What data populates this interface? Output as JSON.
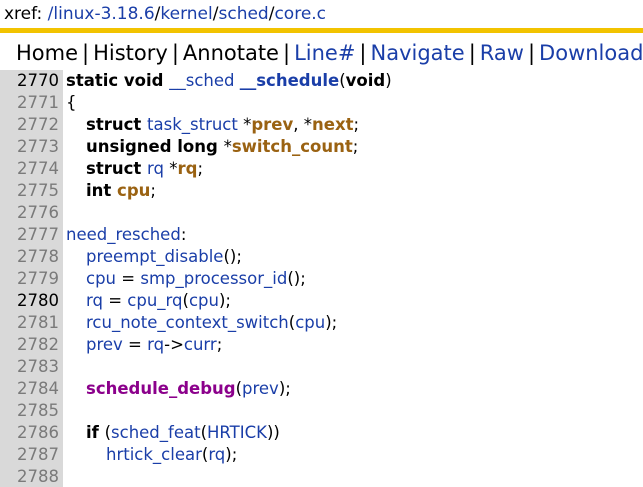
{
  "xref": {
    "prefix": "xref: ",
    "path": [
      {
        "text": "/linux-3.18.6",
        "link": true
      },
      {
        "text": "/",
        "link": false
      },
      {
        "text": "kernel",
        "link": true
      },
      {
        "text": "/",
        "link": false
      },
      {
        "text": "sched",
        "link": true
      },
      {
        "text": "/",
        "link": false
      },
      {
        "text": "core.c",
        "link": true
      }
    ]
  },
  "nav": {
    "items": [
      {
        "label": "Home",
        "link": false
      },
      {
        "label": "History",
        "link": false
      },
      {
        "label": "Annotate",
        "link": false
      },
      {
        "label": "Line#",
        "link": true
      },
      {
        "label": "Navigate",
        "link": true
      },
      {
        "label": "Raw",
        "link": true
      },
      {
        "label": "Download",
        "link": true
      }
    ]
  },
  "colors": {
    "rule": "#f2c300",
    "link": "#1a3ea8",
    "variable": "#9a6212",
    "macro": "#8b008b",
    "gutter": "#d9d9d9"
  },
  "lines": [
    {
      "n": "2770",
      "hl": true,
      "indent": 0,
      "tokens": [
        {
          "t": "static void ",
          "c": "kw"
        },
        {
          "t": "__sched",
          "c": "fn"
        },
        {
          "t": " ",
          "c": "pl"
        },
        {
          "t": "__schedule",
          "c": "fnb"
        },
        {
          "t": "(",
          "c": "pl"
        },
        {
          "t": "void",
          "c": "kw"
        },
        {
          "t": ")",
          "c": "pl"
        }
      ]
    },
    {
      "n": "2771",
      "hl": false,
      "indent": 0,
      "tokens": [
        {
          "t": "{",
          "c": "pl"
        }
      ]
    },
    {
      "n": "2772",
      "hl": false,
      "indent": 1,
      "tokens": [
        {
          "t": "struct ",
          "c": "kw"
        },
        {
          "t": "task_struct",
          "c": "fn"
        },
        {
          "t": " *",
          "c": "pl"
        },
        {
          "t": "prev",
          "c": "var"
        },
        {
          "t": ", *",
          "c": "pl"
        },
        {
          "t": "next",
          "c": "var"
        },
        {
          "t": ";",
          "c": "pl"
        }
      ]
    },
    {
      "n": "2773",
      "hl": false,
      "indent": 1,
      "tokens": [
        {
          "t": "unsigned long ",
          "c": "kw"
        },
        {
          "t": "*",
          "c": "pl"
        },
        {
          "t": "switch_count",
          "c": "var"
        },
        {
          "t": ";",
          "c": "pl"
        }
      ]
    },
    {
      "n": "2774",
      "hl": false,
      "indent": 1,
      "tokens": [
        {
          "t": "struct ",
          "c": "kw"
        },
        {
          "t": "rq",
          "c": "fn"
        },
        {
          "t": " *",
          "c": "pl"
        },
        {
          "t": "rq",
          "c": "var"
        },
        {
          "t": ";",
          "c": "pl"
        }
      ]
    },
    {
      "n": "2775",
      "hl": false,
      "indent": 1,
      "tokens": [
        {
          "t": "int ",
          "c": "kw"
        },
        {
          "t": "cpu",
          "c": "var"
        },
        {
          "t": ";",
          "c": "pl"
        }
      ]
    },
    {
      "n": "2776",
      "hl": false,
      "indent": 0,
      "tokens": []
    },
    {
      "n": "2777",
      "hl": false,
      "indent": 0,
      "tokens": [
        {
          "t": "need_resched",
          "c": "txt"
        },
        {
          "t": ":",
          "c": "pl"
        }
      ]
    },
    {
      "n": "2778",
      "hl": false,
      "indent": 1,
      "tokens": [
        {
          "t": "preempt_disable",
          "c": "fn"
        },
        {
          "t": "();",
          "c": "pl"
        }
      ]
    },
    {
      "n": "2779",
      "hl": false,
      "indent": 1,
      "tokens": [
        {
          "t": "cpu",
          "c": "txt"
        },
        {
          "t": " = ",
          "c": "pl"
        },
        {
          "t": "smp_processor_id",
          "c": "fn"
        },
        {
          "t": "();",
          "c": "pl"
        }
      ]
    },
    {
      "n": "2780",
      "hl": true,
      "indent": 1,
      "tokens": [
        {
          "t": "rq",
          "c": "txt"
        },
        {
          "t": " = ",
          "c": "pl"
        },
        {
          "t": "cpu_rq",
          "c": "fn"
        },
        {
          "t": "(",
          "c": "pl"
        },
        {
          "t": "cpu",
          "c": "txt"
        },
        {
          "t": ");",
          "c": "pl"
        }
      ]
    },
    {
      "n": "2781",
      "hl": false,
      "indent": 1,
      "tokens": [
        {
          "t": "rcu_note_context_switch",
          "c": "fn"
        },
        {
          "t": "(",
          "c": "pl"
        },
        {
          "t": "cpu",
          "c": "txt"
        },
        {
          "t": ");",
          "c": "pl"
        }
      ]
    },
    {
      "n": "2782",
      "hl": false,
      "indent": 1,
      "tokens": [
        {
          "t": "prev",
          "c": "txt"
        },
        {
          "t": " = ",
          "c": "pl"
        },
        {
          "t": "rq",
          "c": "txt"
        },
        {
          "t": "->",
          "c": "pl"
        },
        {
          "t": "curr",
          "c": "txt"
        },
        {
          "t": ";",
          "c": "pl"
        }
      ]
    },
    {
      "n": "2783",
      "hl": false,
      "indent": 0,
      "tokens": []
    },
    {
      "n": "2784",
      "hl": false,
      "indent": 1,
      "tokens": [
        {
          "t": "schedule_debug",
          "c": "mac"
        },
        {
          "t": "(",
          "c": "pl"
        },
        {
          "t": "prev",
          "c": "txt"
        },
        {
          "t": ");",
          "c": "pl"
        }
      ]
    },
    {
      "n": "2785",
      "hl": false,
      "indent": 0,
      "tokens": []
    },
    {
      "n": "2786",
      "hl": false,
      "indent": 1,
      "tokens": [
        {
          "t": "if ",
          "c": "kw"
        },
        {
          "t": "(",
          "c": "pl"
        },
        {
          "t": "sched_feat",
          "c": "fn"
        },
        {
          "t": "(",
          "c": "pl"
        },
        {
          "t": "HRTICK",
          "c": "txt"
        },
        {
          "t": "))",
          "c": "pl"
        }
      ]
    },
    {
      "n": "2787",
      "hl": false,
      "indent": 2,
      "tokens": [
        {
          "t": "hrtick_clear",
          "c": "fn"
        },
        {
          "t": "(",
          "c": "pl"
        },
        {
          "t": "rq",
          "c": "txt"
        },
        {
          "t": ");",
          "c": "pl"
        }
      ]
    },
    {
      "n": "2788",
      "hl": false,
      "indent": 0,
      "tokens": []
    }
  ]
}
